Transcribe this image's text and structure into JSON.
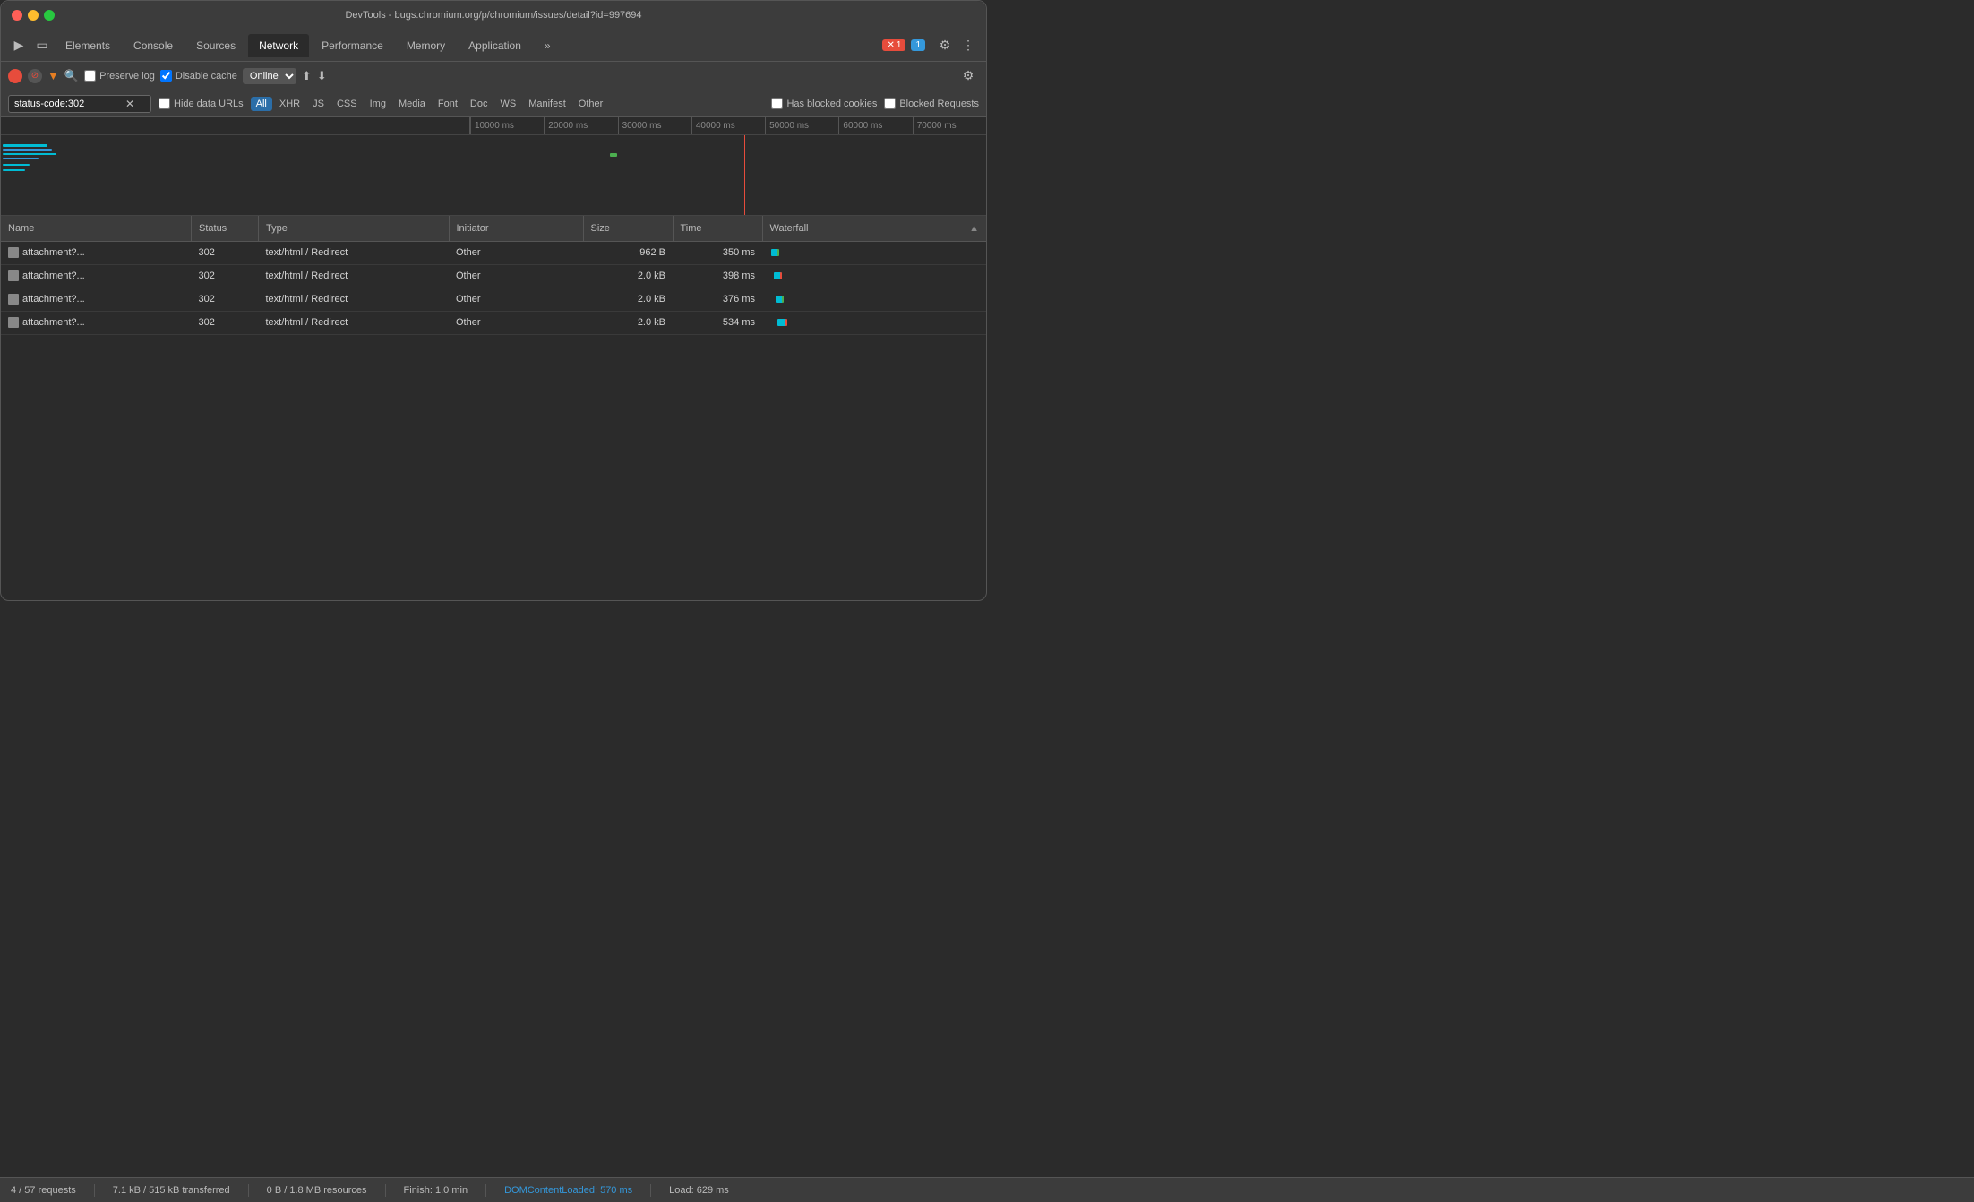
{
  "titleBar": {
    "title": "DevTools - bugs.chromium.org/p/chromium/issues/detail?id=997694"
  },
  "tabs": [
    {
      "label": "Elements",
      "active": false
    },
    {
      "label": "Console",
      "active": false
    },
    {
      "label": "Sources",
      "active": false
    },
    {
      "label": "Network",
      "active": true
    },
    {
      "label": "Performance",
      "active": false
    },
    {
      "label": "Memory",
      "active": false
    },
    {
      "label": "Application",
      "active": false
    }
  ],
  "toolbar": {
    "preserveLog": "Preserve log",
    "disableCache": "Disable cache",
    "online": "Online",
    "moreTabsIcon": "»",
    "errorBadge": "1",
    "warningBadge": "1"
  },
  "filterBar": {
    "searchValue": "status-code:302",
    "hideDataURLs": "Hide data URLs",
    "filterTypes": [
      {
        "label": "All",
        "active": true
      },
      {
        "label": "XHR",
        "active": false
      },
      {
        "label": "JS",
        "active": false
      },
      {
        "label": "CSS",
        "active": false
      },
      {
        "label": "Img",
        "active": false
      },
      {
        "label": "Media",
        "active": false
      },
      {
        "label": "Font",
        "active": false
      },
      {
        "label": "Doc",
        "active": false
      },
      {
        "label": "WS",
        "active": false
      },
      {
        "label": "Manifest",
        "active": false
      },
      {
        "label": "Other",
        "active": false
      }
    ],
    "hasBlockedCookies": "Has blocked cookies",
    "blockedRequests": "Blocked Requests"
  },
  "timeline": {
    "ticks": [
      "10000 ms",
      "20000 ms",
      "30000 ms",
      "40000 ms",
      "50000 ms",
      "60000 ms",
      "70000 ms"
    ]
  },
  "tableHeaders": [
    {
      "label": "Name",
      "key": "name"
    },
    {
      "label": "Status",
      "key": "status"
    },
    {
      "label": "Type",
      "key": "type"
    },
    {
      "label": "Initiator",
      "key": "initiator"
    },
    {
      "label": "Size",
      "key": "size"
    },
    {
      "label": "Time",
      "key": "time"
    },
    {
      "label": "Waterfall",
      "key": "waterfall",
      "sortable": true
    }
  ],
  "tableRows": [
    {
      "name": "attachment?...",
      "status": "302",
      "type": "text/html / Redirect",
      "initiator": "Other",
      "size": "962 B",
      "time": "350 ms",
      "wfLeft": "0%",
      "wfWidth": "3%",
      "wfColor": "#00bcd4"
    },
    {
      "name": "attachment?...",
      "status": "302",
      "type": "text/html / Redirect",
      "initiator": "Other",
      "size": "2.0 kB",
      "time": "398 ms",
      "wfLeft": "0.2%",
      "wfWidth": "3.5%",
      "wfColor": "#00bcd4"
    },
    {
      "name": "attachment?...",
      "status": "302",
      "type": "text/html / Redirect",
      "initiator": "Other",
      "size": "2.0 kB",
      "time": "376 ms",
      "wfLeft": "0.4%",
      "wfWidth": "3.2%",
      "wfColor": "#00bcd4"
    },
    {
      "name": "attachment?...",
      "status": "302",
      "type": "text/html / Redirect",
      "initiator": "Other",
      "size": "2.0 kB",
      "time": "534 ms",
      "wfLeft": "0.6%",
      "wfWidth": "4%",
      "wfColor": "#00bcd4"
    }
  ],
  "statusBar": {
    "requests": "4 / 57 requests",
    "transferred": "7.1 kB / 515 kB transferred",
    "resources": "0 B / 1.8 MB resources",
    "finish": "Finish: 1.0 min",
    "domContentLoaded": "DOMContentLoaded: 570 ms",
    "load": "Load: 629 ms"
  }
}
